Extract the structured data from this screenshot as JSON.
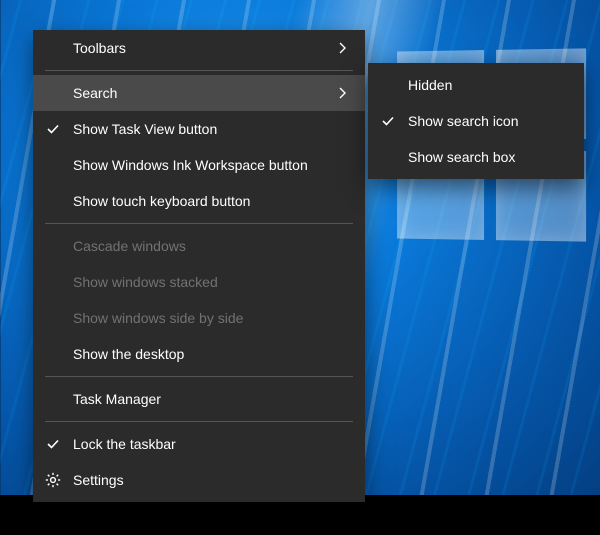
{
  "menu": {
    "toolbars": "Toolbars",
    "search": "Search",
    "show_task_view": "Show Task View button",
    "show_ink": "Show Windows Ink Workspace button",
    "show_touch_kb": "Show touch keyboard button",
    "cascade": "Cascade windows",
    "stacked": "Show windows stacked",
    "side_by_side": "Show windows side by side",
    "show_desktop": "Show the desktop",
    "task_manager": "Task Manager",
    "lock_taskbar": "Lock the taskbar",
    "settings": "Settings"
  },
  "submenu": {
    "hidden": "Hidden",
    "show_icon": "Show search icon",
    "show_box": "Show search box"
  }
}
